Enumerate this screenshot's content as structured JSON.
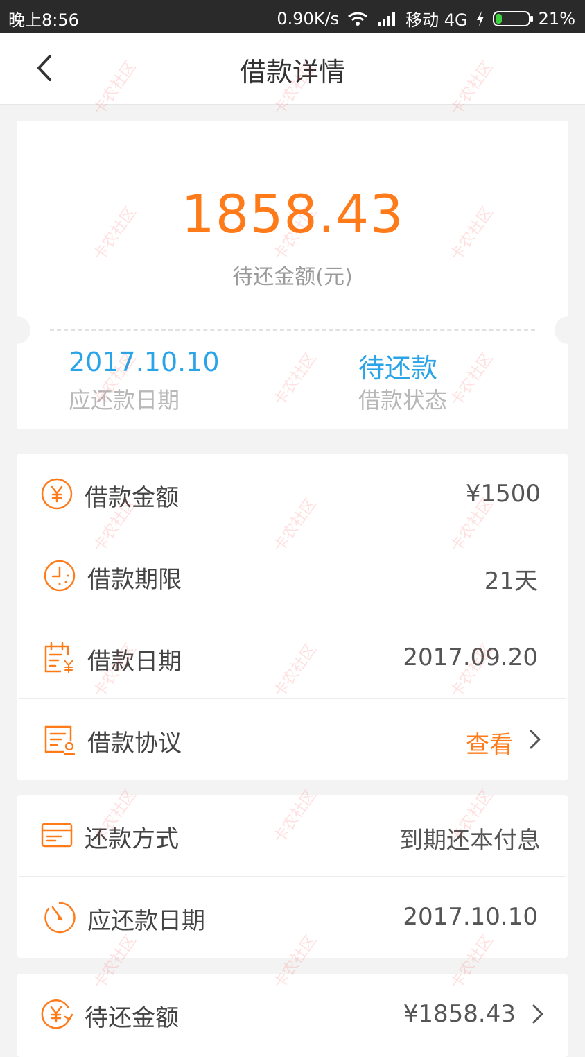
{
  "status_bar": {
    "time": "晚上8:56",
    "speed": "0.90K/s",
    "carrier": "移动 4G",
    "battery": "21%",
    "battery_level": 0.21
  },
  "nav": {
    "title": "借款详情",
    "back_icon": "chevron-left-icon"
  },
  "summary": {
    "amount": "1858.43",
    "amount_label": "待还金额(元)",
    "due_date": "2017.10.10",
    "due_date_label": "应还款日期",
    "status": "待还款",
    "status_label": "借款状态"
  },
  "loan_details": [
    {
      "icon": "yen-circle-icon",
      "label": "借款金额",
      "value": "¥1500"
    },
    {
      "icon": "clock-icon",
      "label": "借款期限",
      "value": "21天"
    },
    {
      "icon": "calendar-yen-icon",
      "label": "借款日期",
      "value": "2017.09.20"
    },
    {
      "icon": "agreement-icon",
      "label": "借款协议",
      "value": "查看",
      "link": true
    }
  ],
  "repayment": [
    {
      "icon": "card-icon",
      "label": "还款方式",
      "value": "到期还本付息"
    },
    {
      "icon": "timer-icon",
      "label": "应还款日期",
      "value": "2017.10.10"
    }
  ],
  "pending": {
    "icon": "yen-refresh-icon",
    "label": "待还金额",
    "value": "¥1858.43"
  },
  "watermark": "卡农社区",
  "colors": {
    "accent": "#ff7b1a",
    "link_blue": "#2aa4e8",
    "status_bar": "#2a2a2a"
  }
}
